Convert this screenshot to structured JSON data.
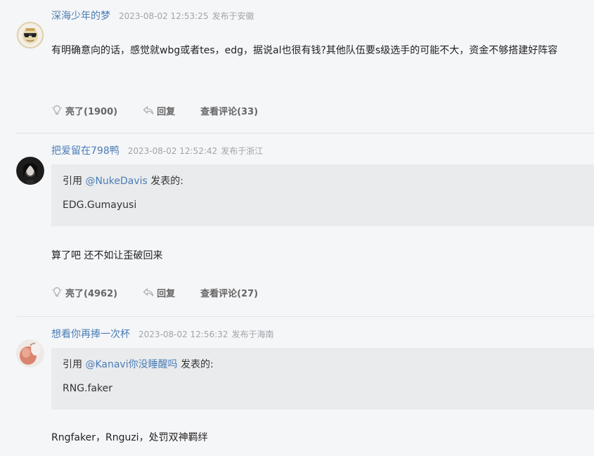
{
  "comments": [
    {
      "username": "深海少年的梦",
      "timestamp": "2023-08-02 12:53:25",
      "location": "发布于安徽",
      "avatar": "sunglasses-avatar",
      "text": "有明确意向的话，感觉就wbg或者tes，edg，据说al也很有钱?其他队伍要s级选手的可能不大，资金不够搭建好阵容",
      "likes": "亮了(1900)",
      "reply": "回复",
      "view_replies": "查看评论(33)"
    },
    {
      "username": "把爱留在798鸭",
      "timestamp": "2023-08-02 12:52:42",
      "location": "发布于浙江",
      "avatar": "dark-portrait-avatar",
      "quote": {
        "prefix": "引用 ",
        "mention": "@NukeDavis",
        "suffix": " 发表的:",
        "text": "EDG.Gumayusi"
      },
      "text": "算了吧 还不如让歪破回来",
      "likes": "亮了(4962)",
      "reply": "回复",
      "view_replies": "查看评论(27)"
    },
    {
      "username": "想看你再捧一次杯",
      "timestamp": "2023-08-02 12:56:32",
      "location": "发布于海南",
      "avatar": "peach-avatar",
      "quote": {
        "prefix": "引用 ",
        "mention": "@Kanavi你没睡醒吗",
        "suffix": " 发表的:",
        "text": "RNG.faker"
      },
      "text": "Rngfaker，Rnguzi，处罚双神羁绊"
    }
  ],
  "icons": {
    "like": "lightbulb-icon",
    "reply": "reply-arrow-icon"
  },
  "colors": {
    "username": "#4a7db5",
    "meta": "#a0a4aa",
    "quote_bg": "#eaebed",
    "page_bg": "#f5f6f8"
  }
}
